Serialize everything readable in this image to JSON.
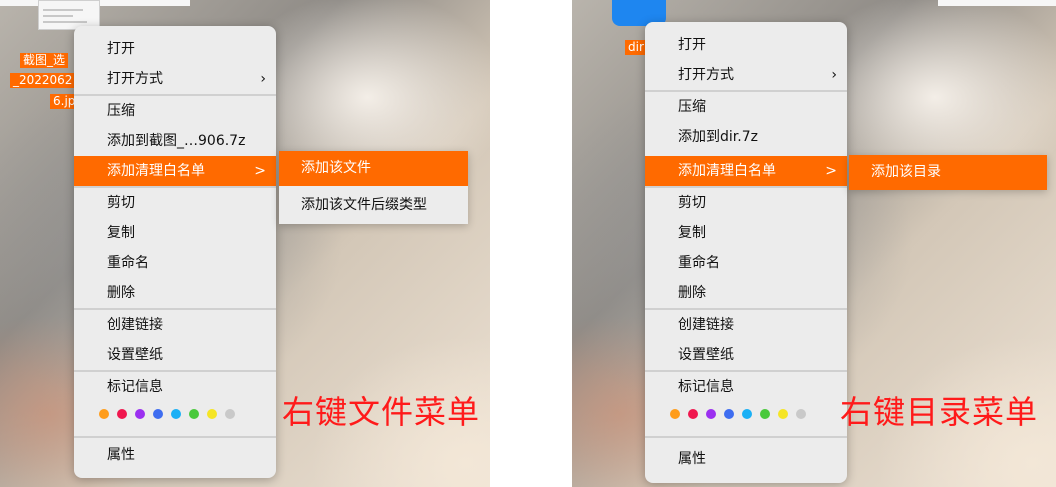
{
  "left_panel": {
    "desktop_file_label": [
      "截图_选",
      "_2022062",
      "6.jp"
    ],
    "menu_items": {
      "open": "打开",
      "open_with": "打开方式",
      "compress": "压缩",
      "add_to_archive": "添加到截图_…906.7z",
      "add_cleanup_whitelist": "添加清理白名单",
      "cut": "剪切",
      "copy": "复制",
      "rename": "重命名",
      "delete": "删除",
      "create_link": "创建链接",
      "set_wallpaper": "设置壁纸",
      "tag_info": "标记信息",
      "properties": "属性"
    },
    "submenu_items": {
      "add_file": "添加该文件",
      "add_file_ext_type": "添加该文件后缀类型"
    },
    "caption": "右键文件菜单"
  },
  "right_panel": {
    "desktop_folder_label": "dir",
    "menu_items": {
      "open": "打开",
      "open_with": "打开方式",
      "compress": "压缩",
      "add_to_archive": "添加到dir.7z",
      "add_cleanup_whitelist": "添加清理白名单",
      "cut": "剪切",
      "copy": "复制",
      "rename": "重命名",
      "delete": "删除",
      "create_link": "创建链接",
      "set_wallpaper": "设置壁纸",
      "tag_info": "标记信息",
      "properties": "属性"
    },
    "submenu_items": {
      "add_directory": "添加该目录"
    },
    "caption": "右键目录菜单"
  },
  "submenu_arrow_glyph": "›",
  "highlight_arrow_glyph": ">",
  "tag_colors": [
    "#ff9c1a",
    "#f0174e",
    "#9b30f0",
    "#3e6df0",
    "#1ab0f5",
    "#49c93c",
    "#f5e525",
    "#c9c9c9"
  ],
  "accent_color": "#ff6a00",
  "caption_color": "#ff1a1a"
}
